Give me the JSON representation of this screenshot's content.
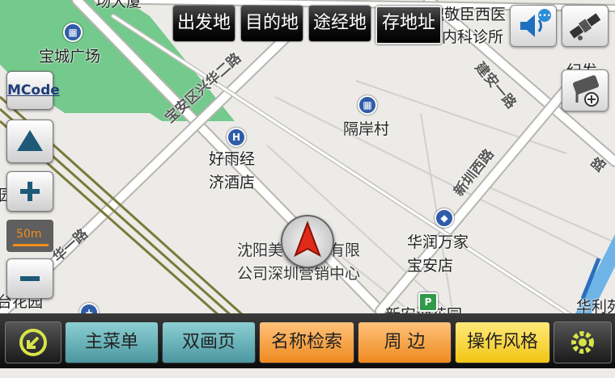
{
  "top_nav": {
    "departure": "出发地",
    "destination": "目的地",
    "waypoint": "途经地",
    "save_address": "存地址"
  },
  "map_labels": {
    "baocheng_square": "宝城广场",
    "gean_village": "隔岸村",
    "haoyu_hotel_l1": "好雨经",
    "haoyu_hotel_l2": "济酒店",
    "huarun_l1": "华润万家",
    "huarun_l2": "宝安店",
    "clinic_l1": "魏敬臣西医",
    "clinic_l2": "内科诊所",
    "company_l1": "沈阳美行科技有限",
    "company_l2": "公司深圳营销中心",
    "top_left_partial": "场大厦",
    "left_partial": "园",
    "bottom_left_partial": "台花园",
    "bottom_right_partial": "华利苑",
    "bottom_mid_partial": "新安湖花园",
    "right_partial": "纪发"
  },
  "road_labels": {
    "xinghua_road": "宝安区兴华二路",
    "jianan_road": "建安一路",
    "xinhu_road": "新圳西路",
    "xinhua_left": "华一路",
    "right_road": "路"
  },
  "scale": {
    "value": "50m"
  },
  "side": {
    "mcode": "MCode"
  },
  "bottom_bar": {
    "main_menu": "主菜单",
    "dual_screen": "双画页",
    "name_search": "名称检索",
    "nearby": "周 边",
    "style": "操作风格"
  },
  "colors": {
    "map_bg": "#ecebe8",
    "park": "#74c98c",
    "road": "#ffffff",
    "highway": "#7a7a3a",
    "teal_button": "#4b97a0",
    "orange_button": "#ee8a1f",
    "yellow_button": "#f2c514"
  },
  "icons": {
    "volume": "speaker-icon",
    "gps": "satellite-icon",
    "camera": "camera-add-icon",
    "compass": "compass-arrow-icon",
    "zoom_in": "plus-icon",
    "zoom_out": "minus-icon",
    "settings": "gear-icon",
    "back": "back-arrow-icon",
    "vehicle": "car-position-icon"
  }
}
